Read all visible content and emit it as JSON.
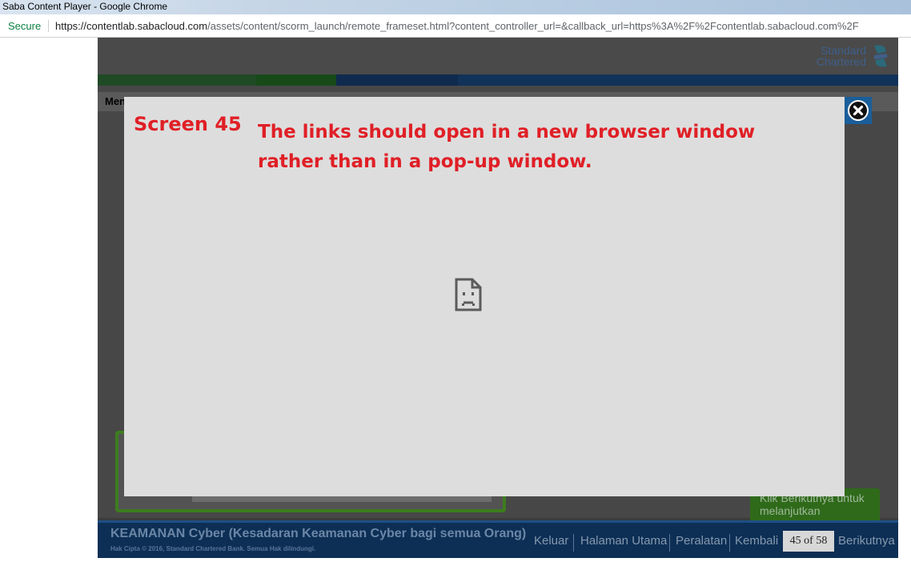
{
  "window": {
    "title": "Saba Content Player - Google Chrome"
  },
  "address_bar": {
    "security_label": "Secure",
    "url_prefix": "https://",
    "url_host": "contentlab.sabacloud.com",
    "url_rest": "/assets/content/scorm_launch/remote_frameset.html?content_controller_url=&callback_url=https%3A%2F%2Fcontentlab.sabacloud.com%2F"
  },
  "player": {
    "logo_line1": "Standard",
    "logo_line2": "Chartered",
    "content_heading_fragment": "Men",
    "tooltip_text": "Klik Berikutnya untuk melanjutkan",
    "footer": {
      "course_title": "KEAMANAN Cyber (Kesadaran Keamanan Cyber bagi semua Orang)",
      "copyright": "Hak Cipta © 2016, Standard Chartered Bank. Semua Hak dilindungi.",
      "nav": {
        "exit": "Keluar",
        "home": "Halaman Utama",
        "tools": "Peralatan",
        "back": "Kembali",
        "page_indicator": "45 of 58",
        "next": "Berikutnya"
      }
    }
  },
  "modal": {
    "screen_label": "Screen 45",
    "message": "The links should open in a new browser window rather than in a pop-up window.",
    "icon": "sad-page-icon",
    "close_icon": "close-icon"
  },
  "colors": {
    "message_red": "#e01f26",
    "footer_navy": "#0d2f55",
    "modal_grey": "#dddddd"
  }
}
